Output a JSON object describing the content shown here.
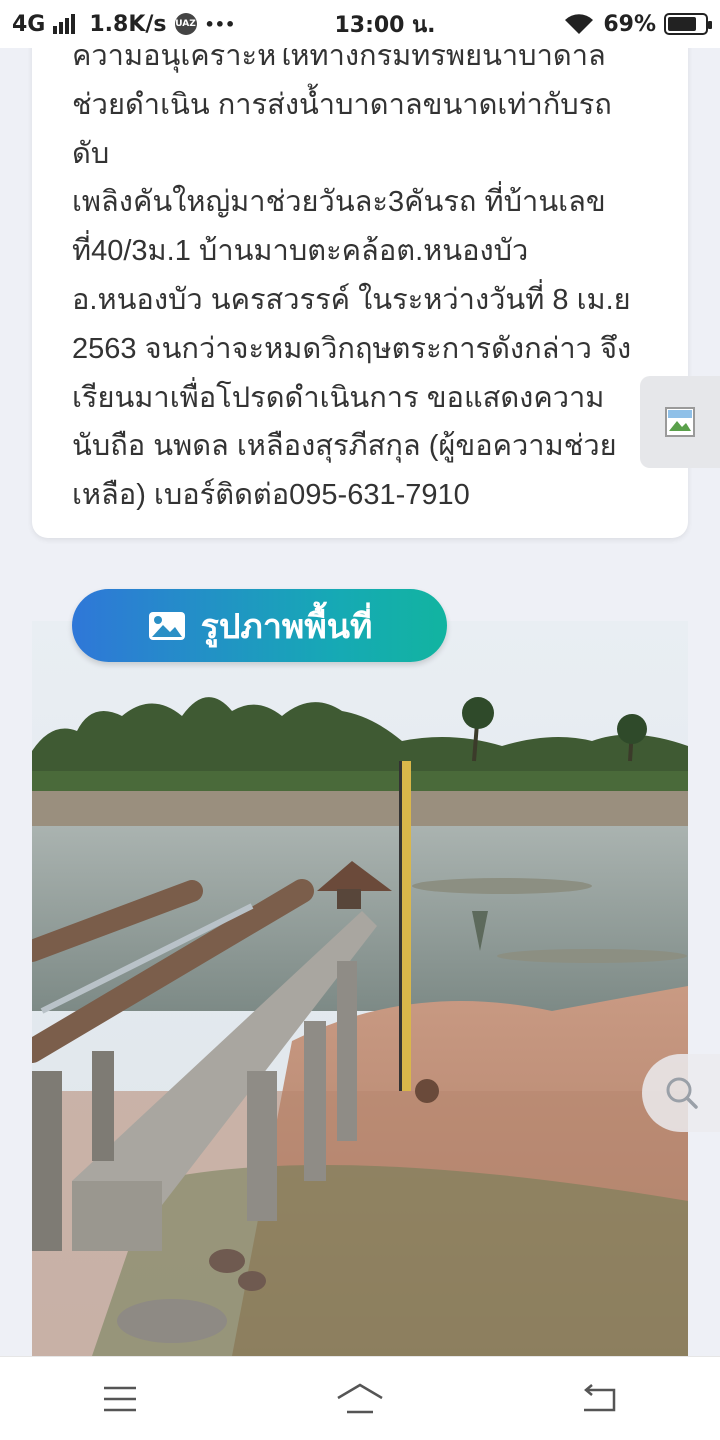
{
  "status_bar": {
    "network": "4G",
    "speed": "1.8K/s",
    "badge": "UAZ",
    "more": "•••",
    "time": "13:00 น.",
    "battery": "69%",
    "battery_level": 0.69,
    "icons": [
      "signal-icon",
      "wifi-icon",
      "battery-icon"
    ]
  },
  "request": {
    "lines": [
      "ความอนุเคราะห์ให้ทางกรมทรัพย์น้ำบาดาล",
      "ช่วยดำเนิน การส่งน้ำบาดาลขนาดเท่ากับรถดับ",
      "เพลิงคันใหญ่มาช่วยวันละ3คันรถ ที่บ้านเลข",
      "ที่40/3ม.1 บ้านมาบตะคล้อต.หนองบัว",
      "อ.หนองบัว นครสวรรค์ ในระหว่างวันที่ 8 เม.ย",
      "2563 จนกว่าจะหมดวิกฤษตระการดังกล่าว จึง",
      "เรียนมาเพื่อโปรดดำเนินการ ขอแสดงความ",
      "นับถือ นพดล เหลืองสุรภีสกุล (ผู้ขอความช่วย",
      "เหลือ) เบอร์ติดต่อ095-631-7910"
    ]
  },
  "section": {
    "title": "รูปภาพพื้นที่",
    "icon": "image-icon"
  },
  "side_tab": {
    "icon": "broken-image-icon"
  },
  "fab": {
    "icon": "search-icon"
  },
  "bottom_nav": {
    "icons": [
      "menu-icon",
      "home-icon",
      "back-icon"
    ]
  },
  "colors": {
    "background": "#eef0f6",
    "pill_start": "#2f77d8",
    "pill_end": "#12b4a0",
    "text": "#333333"
  }
}
